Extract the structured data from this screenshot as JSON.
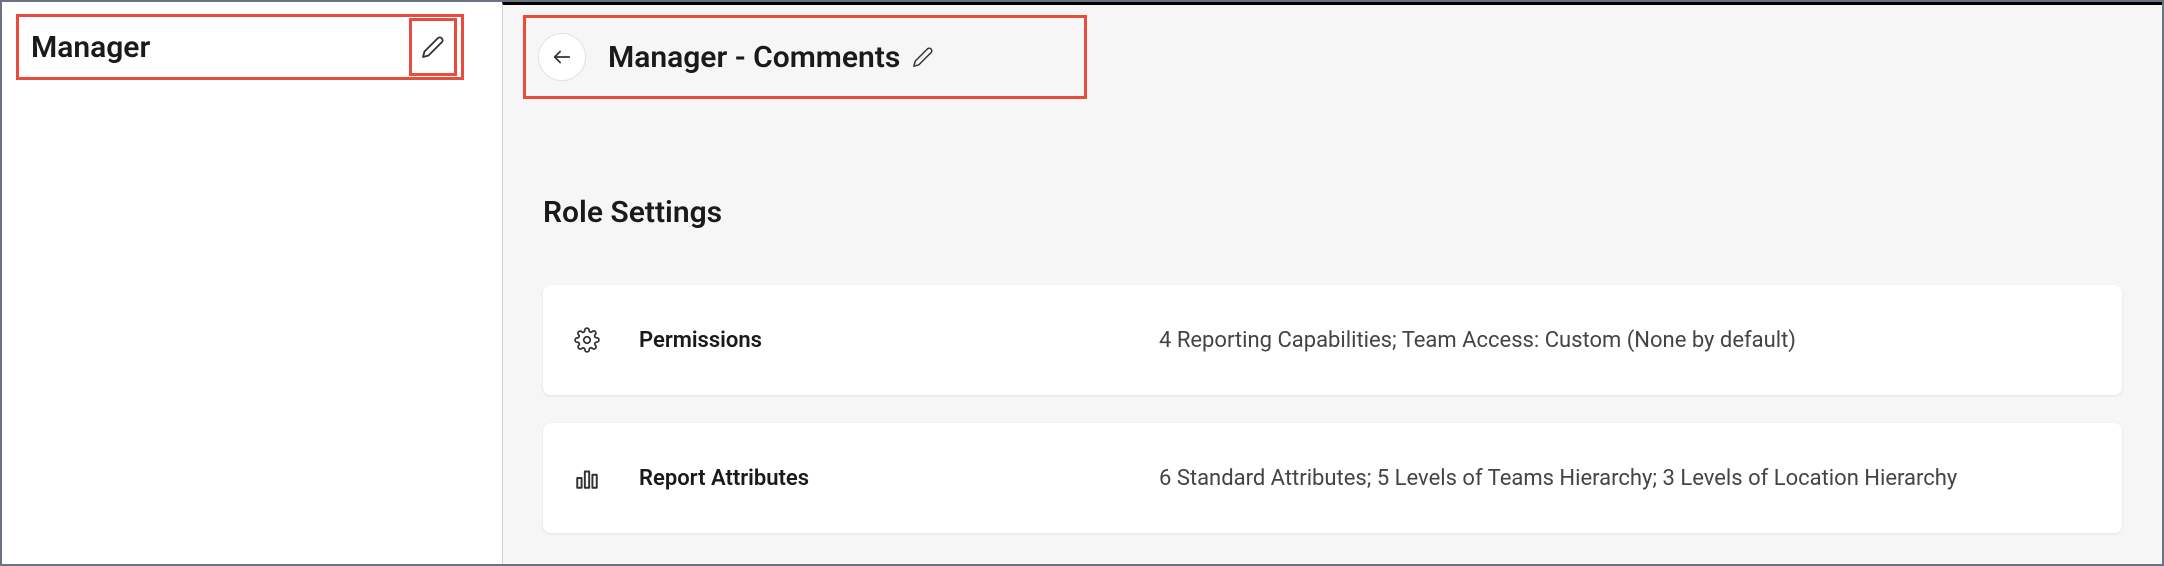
{
  "sidebar": {
    "title": "Manager"
  },
  "header": {
    "title": "Manager - Comments"
  },
  "section": {
    "title": "Role Settings"
  },
  "cards": {
    "permissions": {
      "label": "Permissions",
      "description": "4 Reporting Capabilities; Team Access: Custom (None by default)"
    },
    "reportAttributes": {
      "label": "Report Attributes",
      "description": "6 Standard Attributes; 5 Levels of Teams Hierarchy; 3 Levels of Location Hierarchy"
    }
  }
}
